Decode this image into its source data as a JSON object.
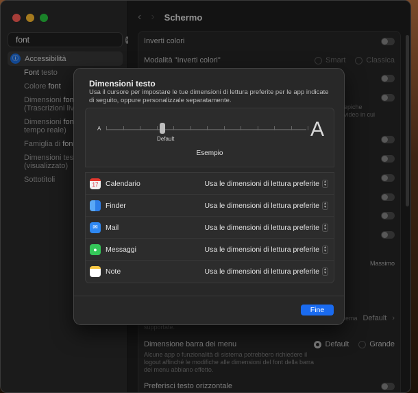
{
  "sidebar": {
    "search_value": "font",
    "items": [
      {
        "label": "Accessibilità"
      },
      {
        "label_hl": "Font",
        "label_rest": " testo"
      },
      {
        "label_pre": "Colore ",
        "label_hl": "font"
      },
      {
        "label_pre": "Dimensioni ",
        "label_hl": "font",
        "label_rest2": "(Trascrizioni live)"
      },
      {
        "label_pre": "Dimensioni ",
        "label_hl": "font",
        "label_rest2": "tempo reale)"
      },
      {
        "label_pre": "Famiglia di ",
        "label_hl": "font"
      },
      {
        "label_line1": "Dimensioni testo",
        "label_line2": "(visualizzato)"
      },
      {
        "label": "Sottotitoli"
      }
    ]
  },
  "header": {
    "title": "Schermo"
  },
  "settings": {
    "invert": "Inverti colori",
    "invert_mode": "Modalità \"Inverti colori\"",
    "smart": "Smart",
    "classic": "Classica",
    "partial_text1": "epiche",
    "partial_text2": "video in cui",
    "maximum": "Massimo",
    "system_partial": "sistema",
    "system_default": "Default",
    "supported": "supportate.",
    "menubar_title": "Dimensione barra dei menu",
    "menubar_desc": "Alcune app o funzionalità di sistema potrebbero richiedere il logout affinché le modifiche alle dimensioni del font della barra dei menu abbiano effetto.",
    "menubar_default": "Default",
    "menubar_large": "Grande",
    "horizontal_text": "Preferisci testo orizzontale"
  },
  "modal": {
    "title": "Dimensioni testo",
    "description": "Usa il cursore per impostare le tue dimensioni di lettura preferite per le app indicate di seguito, oppure personalizzale separatamente.",
    "small_a": "A",
    "big_a": "A",
    "slider_label": "Default",
    "slider_position": 0.28,
    "sample": "Esempio",
    "apps": [
      {
        "name": "Calendario",
        "icon": "calendar-icon",
        "value": "Usa le dimensioni di lettura preferite"
      },
      {
        "name": "Finder",
        "icon": "finder-icon",
        "value": "Usa le dimensioni di lettura preferite"
      },
      {
        "name": "Mail",
        "icon": "mail-icon",
        "value": "Usa le dimensioni di lettura preferite"
      },
      {
        "name": "Messaggi",
        "icon": "messages-icon",
        "value": "Usa le dimensioni di lettura preferite"
      },
      {
        "name": "Note",
        "icon": "notes-icon",
        "value": "Usa le dimensioni di lettura preferite"
      }
    ],
    "calendar_day": "17",
    "done_label": "Fine"
  },
  "colors": {
    "accent": "#1a6bf0",
    "background": "#1e1e1e",
    "modal": "#282828"
  }
}
